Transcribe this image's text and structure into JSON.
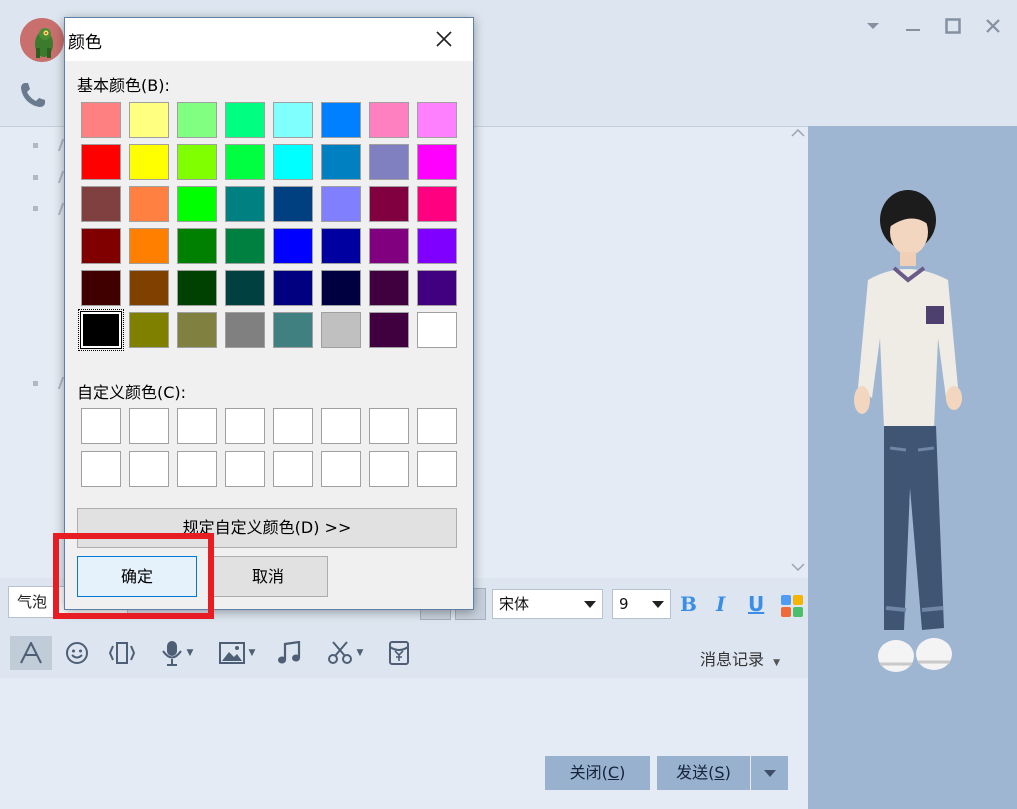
{
  "chat": {
    "bubble_label": "气泡",
    "font_name": "宋体",
    "font_size": "9",
    "bold_label": "B",
    "italic_label": "I",
    "underline_label": "U",
    "history_label": "消息记录",
    "close_label": "关闭(",
    "close_key": "C",
    "close_tail": ")",
    "send_label": "发送(",
    "send_key": "S",
    "send_tail": ")"
  },
  "dialog": {
    "title": "颜色",
    "basic_label": "基本颜色(B):",
    "custom_label": "自定义颜色(C):",
    "define_label": "规定自定义颜色(D) >>",
    "ok_label": "确定",
    "cancel_label": "取消",
    "basic_colors": [
      [
        "#ff8080",
        "#ffff80",
        "#80ff80",
        "#00ff80",
        "#80ffff",
        "#0080ff",
        "#ff80c0",
        "#ff80ff"
      ],
      [
        "#ff0000",
        "#ffff00",
        "#80ff00",
        "#00ff40",
        "#00ffff",
        "#0080c0",
        "#8080c0",
        "#ff00ff"
      ],
      [
        "#804040",
        "#ff8040",
        "#00ff00",
        "#008080",
        "#004080",
        "#8080ff",
        "#800040",
        "#ff0080"
      ],
      [
        "#800000",
        "#ff8000",
        "#008000",
        "#008040",
        "#0000ff",
        "#0000a0",
        "#800080",
        "#8000ff"
      ],
      [
        "#400000",
        "#804000",
        "#004000",
        "#004040",
        "#000080",
        "#000040",
        "#400040",
        "#400080"
      ],
      [
        "#000000",
        "#808000",
        "#808040",
        "#808080",
        "#408080",
        "#c0c0c0",
        "#400040",
        "#ffffff"
      ]
    ],
    "selected_color": "#000000",
    "custom_colors": [
      [
        "#ffffff",
        "#ffffff",
        "#ffffff",
        "#ffffff",
        "#ffffff",
        "#ffffff",
        "#ffffff",
        "#ffffff"
      ],
      [
        "#ffffff",
        "#ffffff",
        "#ffffff",
        "#ffffff",
        "#ffffff",
        "#ffffff",
        "#ffffff",
        "#ffffff"
      ]
    ]
  },
  "icons": [
    "avatar",
    "phone-icon",
    "minimize-icon",
    "maximize-icon",
    "close-icon",
    "dropdown-icon",
    "font-icon",
    "emoji-icon",
    "shake-icon",
    "voice-icon",
    "image-icon",
    "music-icon",
    "scissors-icon",
    "red-packet-icon",
    "palette-icon"
  ],
  "colors": {
    "accent": "#0078d7",
    "highlight": "#e81d24",
    "send_button": "#97b1cf",
    "panel": "#9fb6d3"
  }
}
